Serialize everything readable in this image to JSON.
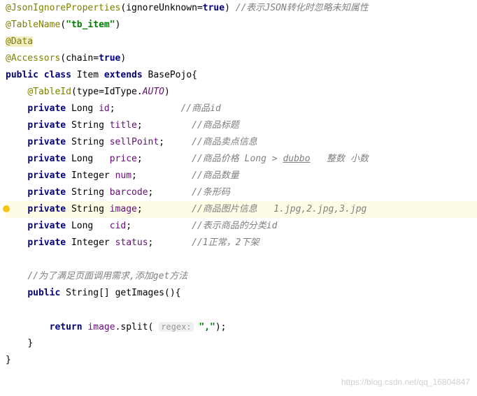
{
  "lines": {
    "l1": {
      "ann": "@JsonIgnoreProperties",
      "args_open": "(",
      "p": "ignoreUnknown",
      "eq": "=",
      "v": "true",
      "args_close": ")",
      "sp": " ",
      "cmt": "//表示JSON转化时忽略未知属性"
    },
    "l2": {
      "ann": "@TableName",
      "args_open": "(",
      "str": "\"tb_item\"",
      "args_close": ")"
    },
    "l3": {
      "ann": "@Data"
    },
    "l4": {
      "ann": "@Accessors",
      "args_open": "(",
      "p": "chain",
      "eq": "=",
      "v": "true",
      "args_close": ")"
    },
    "l5": {
      "kw1": "public",
      "sp1": " ",
      "kw2": "class",
      "sp2": " ",
      "name": "Item",
      "sp3": " ",
      "kw3": "extends",
      "sp4": " ",
      "base": "BasePojo",
      "brace": "{"
    },
    "l6": {
      "indent": "    ",
      "ann": "@TableId",
      "args_open": "(",
      "p": "type",
      "eq": "=",
      "cls": "IdType",
      "dot": ".",
      "const": "AUTO",
      "args_close": ")"
    },
    "l7": {
      "indent": "    ",
      "kw": "private",
      "sp": " ",
      "type": "Long",
      "sp2": " ",
      "field": "id",
      "semi": ";",
      "pad": "            ",
      "cmt": "//商品id"
    },
    "l8": {
      "indent": "    ",
      "kw": "private",
      "sp": " ",
      "type": "String",
      "sp2": " ",
      "field": "title",
      "semi": ";",
      "pad": "         ",
      "cmt": "//商品标题"
    },
    "l9": {
      "indent": "    ",
      "kw": "private",
      "sp": " ",
      "type": "String",
      "sp2": " ",
      "field": "sellPoint",
      "semi": ";",
      "pad": "     ",
      "cmt": "//商品卖点信息"
    },
    "l10": {
      "indent": "    ",
      "kw": "private",
      "sp": " ",
      "type": "Long",
      "sp2": "   ",
      "field": "price",
      "semi": ";",
      "pad": "         ",
      "cmt1": "//商品价格 Long > ",
      "cmt_em": "dubbo",
      "cmt2": "   整数 小数"
    },
    "l11": {
      "indent": "    ",
      "kw": "private",
      "sp": " ",
      "type": "Integer",
      "sp2": " ",
      "field": "num",
      "semi": ";",
      "pad": "          ",
      "cmt": "//商品数量"
    },
    "l12": {
      "indent": "    ",
      "kw": "private",
      "sp": " ",
      "type": "String",
      "sp2": " ",
      "field": "barcode",
      "semi": ";",
      "pad": "       ",
      "cmt": "//条形码"
    },
    "l13": {
      "indent": "    ",
      "kw": "private",
      "sp": " ",
      "type": "String",
      "sp2": " ",
      "field": "image",
      "semi": ";",
      "pad": "         ",
      "cmt": "//商品图片信息   1.jpg,2.jpg,3.jpg"
    },
    "l14": {
      "indent": "    ",
      "kw": "private",
      "sp": " ",
      "type": "Long",
      "sp2": "   ",
      "field": "cid",
      "semi": ";",
      "pad": "           ",
      "cmt": "//表示商品的分类id"
    },
    "l15": {
      "indent": "    ",
      "kw": "private",
      "sp": " ",
      "type": "Integer",
      "sp2": " ",
      "field": "status",
      "semi": ";",
      "pad": "       ",
      "cmt": "//1正常，2下架"
    },
    "l17": {
      "indent": "    ",
      "cmt": "//为了满足页面调用需求,添加get方法"
    },
    "l18": {
      "indent": "    ",
      "kw": "public",
      "sp": " ",
      "type": "String",
      "arr": "[]",
      "sp2": " ",
      "method": "getImages",
      "paren": "(){"
    },
    "l20": {
      "indent": "        ",
      "kw": "return",
      "sp": " ",
      "field": "image",
      "dot": ".",
      "method": "split",
      "open": "( ",
      "hint": "regex:",
      "sp2": " ",
      "str": "\",\"",
      "close": ");"
    },
    "l21": {
      "indent": "    ",
      "brace": "}"
    },
    "l22": {
      "brace": "}"
    }
  },
  "watermark": "https://blog.csdn.net/qq_16804847"
}
